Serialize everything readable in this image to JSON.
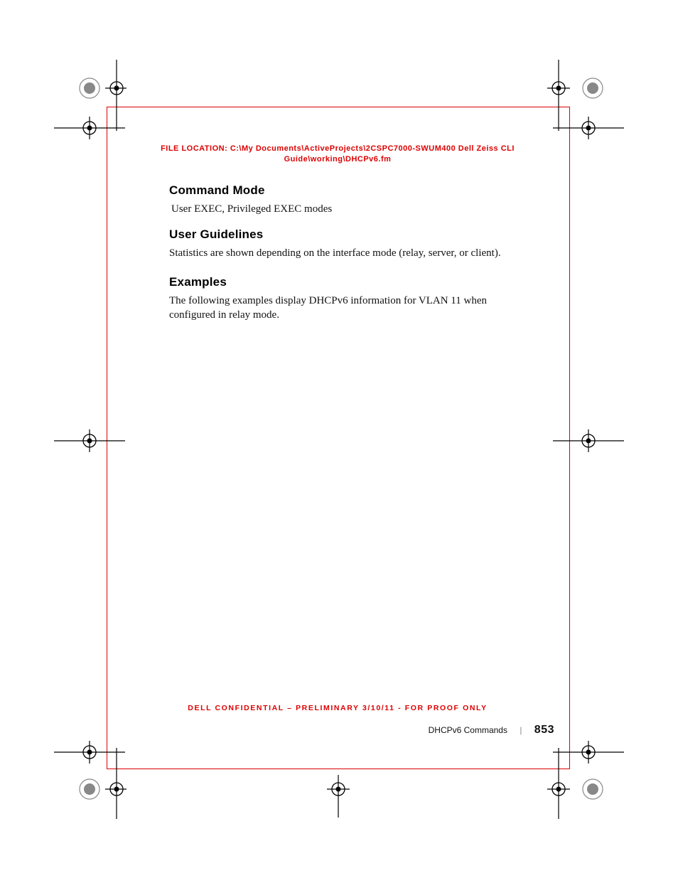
{
  "file_location": {
    "label": "FILE LOCATION:",
    "path": "C:\\My Documents\\ActiveProjects\\2CSPC7000-SWUM400 Dell Zeiss CLI Guide\\working\\DHCPv6.fm"
  },
  "sections": {
    "command_mode": {
      "heading": "Command Mode",
      "text": "User EXEC, Privileged EXEC modes"
    },
    "user_guidelines": {
      "heading": "User Guidelines",
      "text": "Statistics are shown depending on the interface mode (relay, server, or client)."
    },
    "examples": {
      "heading": "Examples",
      "text": "The following examples display DHCPv6 information for VLAN 11 when configured in relay mode."
    }
  },
  "confidential": "DELL CONFIDENTIAL – PRELIMINARY 3/10/11 - FOR PROOF ONLY",
  "footer": {
    "section": "DHCPv6 Commands",
    "separator": "|",
    "page": "853"
  }
}
